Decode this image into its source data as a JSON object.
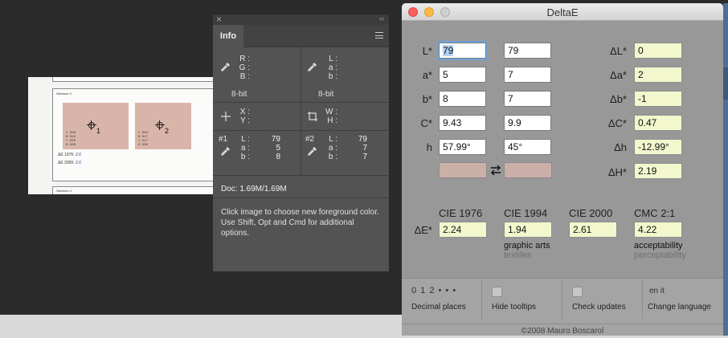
{
  "document": {
    "sheet_title_top": "Skintone 3",
    "sheet_title_bottom": "Skintone 4",
    "swatch1_text": [
      "C 008",
      "M 016",
      "Y 020",
      "K 000"
    ],
    "swatch2_text": [
      "C 004",
      "M 017",
      "Y 017",
      "K 000"
    ],
    "marker1": "1",
    "marker2": "2",
    "de1976_label": "ΔE 1976:",
    "de1976_value": "2.6",
    "de2000_label": "ΔE 2000:",
    "de2000_value": "2.6"
  },
  "info": {
    "tab": "Info",
    "rgb_labels": [
      "R :",
      "G :",
      "B :"
    ],
    "lab_labels": [
      "L :",
      "a :",
      "b :"
    ],
    "bit_left": "8-bit",
    "bit_right": "8-bit",
    "xy_labels": [
      "X :",
      "Y :"
    ],
    "wh_labels": [
      "W :",
      "H :"
    ],
    "sample1": {
      "tag": "#1",
      "labels": [
        "L :",
        "a :",
        "b :"
      ],
      "values": [
        "79",
        "5",
        "8"
      ]
    },
    "sample2": {
      "tag": "#2",
      "labels": [
        "L :",
        "a :",
        "b :"
      ],
      "values": [
        "79",
        "7",
        "7"
      ]
    },
    "doc_size": "Doc: 1.69M/1.69M",
    "hint": "Click image to choose new foreground color.  Use Shift, Opt and Cmd for additional options."
  },
  "deltae": {
    "title": "DeltaE",
    "rows": [
      {
        "label": "L*",
        "v1": "79",
        "v2": "79",
        "dlabel": "ΔL*",
        "dval": "0"
      },
      {
        "label": "a*",
        "v1": "5",
        "v2": "7",
        "dlabel": "Δa*",
        "dval": "2"
      },
      {
        "label": "b*",
        "v1": "8",
        "v2": "7",
        "dlabel": "Δb*",
        "dval": "-1"
      },
      {
        "label": "C*",
        "v1": "9.43",
        "v2": "9.9",
        "dlabel": "ΔC*",
        "dval": "0.47"
      },
      {
        "label": "h",
        "v1": "57.99°",
        "v2": "45°",
        "dlabel": "Δh",
        "dval": "-12.99°"
      }
    ],
    "dH_label": "ΔH*",
    "dH_value": "2.19",
    "swatch1_color": "#cbb0a6",
    "swatch2_color": "#ccaea9",
    "de_label": "ΔE*",
    "formulas": [
      {
        "name": "CIE 1976",
        "value": "2.24",
        "sub1": "",
        "sub2": ""
      },
      {
        "name": "CIE 1994",
        "value": "1.94",
        "sub1": "graphic arts",
        "sub2": "textiles"
      },
      {
        "name": "CIE 2000",
        "value": "2.61",
        "sub1": "",
        "sub2": ""
      },
      {
        "name": "CMC 2:1",
        "value": "4.22",
        "sub1": "acceptability",
        "sub2": "perceptability"
      }
    ],
    "toolbar": {
      "decimal_digits": "0 1 2 • • •",
      "decimal_label": "Decimal places",
      "tooltips_label": "Hide tooltips",
      "updates_label": "Check updates",
      "lang_options": "en  it",
      "lang_label": "Change language"
    },
    "copyright": "©2008 Mauro Boscarol"
  }
}
